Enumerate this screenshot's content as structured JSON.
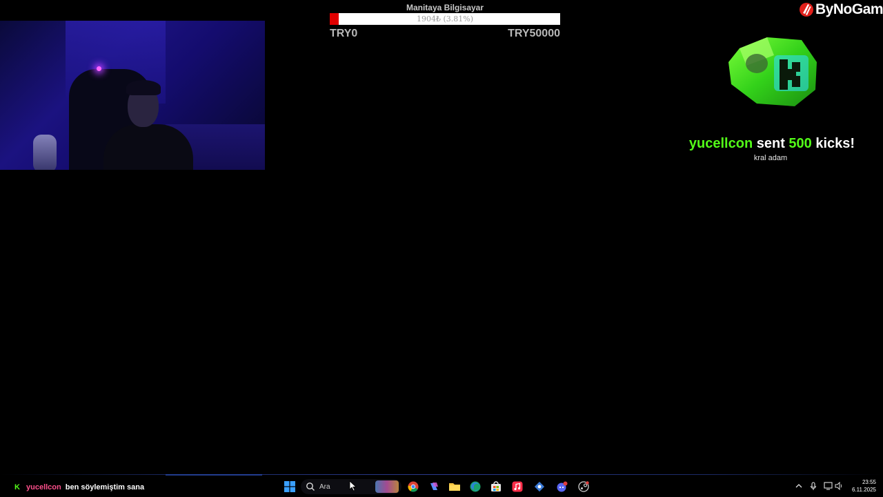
{
  "webcam": {
    "label": ""
  },
  "goal": {
    "title": "Manitaya Bilgisayar",
    "progress_text": "1904₺ (3.81%)",
    "progress_fraction": 0.0381,
    "min_label": "TRY0",
    "max_label": "TRY50000",
    "fill_color": "#e00000"
  },
  "logo": {
    "text": "ByNoGame"
  },
  "alert": {
    "username": "yucellcon",
    "sent_word": "sent",
    "amount": "500",
    "unit_word": "kicks!",
    "message": "kral adam",
    "accent_color": "#53fc18"
  },
  "chat": {
    "platform_icon": "kick-icon",
    "username": "yucellcon",
    "message": "ben söylemiştim sana"
  },
  "taskbar": {
    "search_placeholder": "Ara",
    "icons": [
      "windows-start-icon",
      "search-icon",
      "chrome-icon",
      "copilot-icon",
      "file-explorer-icon",
      "edge-icon",
      "microsoft-store-icon",
      "apple-music-icon",
      "network-app-icon",
      "discord-icon",
      "steam-icon"
    ],
    "tray_icons": [
      "chevron-up-icon",
      "microphone-icon",
      "display-icon",
      "speaker-icon"
    ],
    "time": "23:55",
    "date": "6.11.2025"
  }
}
